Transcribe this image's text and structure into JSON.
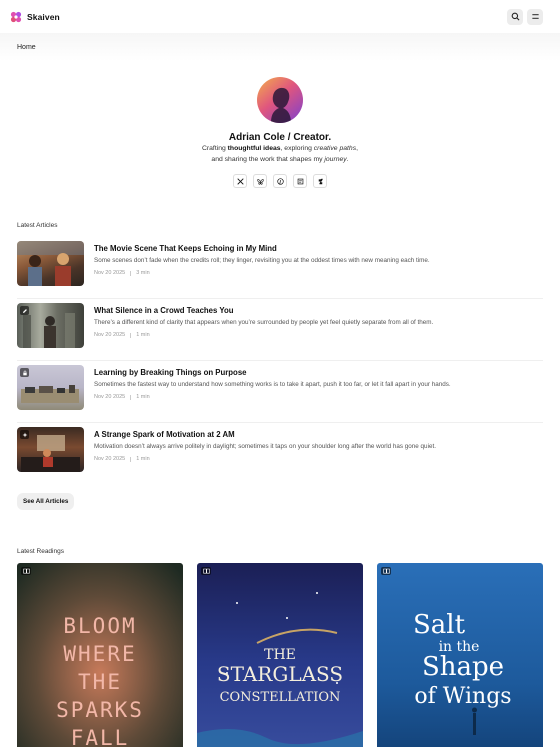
{
  "brand": {
    "name": "Skaiven"
  },
  "breadcrumb": {
    "home": "Home"
  },
  "hero": {
    "name": "Adrian Cole / Creator.",
    "line1_a": "Crafting ",
    "line1_b": "thoughtful ideas",
    "line1_c": ", exploring ",
    "line1_d": "creative paths",
    "line1_e": ",",
    "line2_a": "and sharing the work that shapes my ",
    "line2_b": "journey",
    "line2_c": ".",
    "socials": [
      "x-icon",
      "bluesky-icon",
      "pinterest-icon",
      "flipboard-icon",
      "deviantart-icon"
    ]
  },
  "articles_section": {
    "title": "Latest Articles",
    "see_all": "See All Articles"
  },
  "articles": [
    {
      "title": "The Movie Scene That Keeps Echoing in My Mind",
      "desc": "Some scenes don’t fade when the credits roll; they linger, revisiting you at the oddest times with new meaning each time.",
      "date": "Nov 20 2025",
      "read": "3 min",
      "badge": ""
    },
    {
      "title": "What Silence in a Crowd Teaches You",
      "desc": "There’s a different kind of clarity that appears when you’re surrounded by people yet feel quietly separate from all of them.",
      "date": "Nov 20 2025",
      "read": "1 min",
      "badge": "pen-icon"
    },
    {
      "title": "Learning by Breaking Things on Purpose",
      "desc": "Sometimes the fastest way to understand how something works is to take it apart, push it too far, or let it fall apart in your hands.",
      "date": "Nov 20 2025",
      "read": "1 min",
      "badge": "lock-icon"
    },
    {
      "title": "A Strange Spark of Motivation at 2 AM",
      "desc": "Motivation doesn’t always arrive politely in daylight; sometimes it taps on your shoulder long after the world has gone quiet.",
      "date": "Nov 20 2025",
      "read": "1 min",
      "badge": "sparkle-icon"
    }
  ],
  "readings_section": {
    "title": "Latest Readings"
  },
  "books": [
    {
      "cover_lines": [
        "BLOOM",
        "WHERE",
        "THE",
        "SPARKS",
        "FALL"
      ]
    },
    {
      "cover_lines": [
        "THE",
        "STARGLASS",
        "CONSTELLATION"
      ]
    },
    {
      "cover_lines": [
        "Salt",
        "in the",
        "Shape",
        "of Wings"
      ]
    }
  ],
  "colors": {
    "accent": "#e04fb0",
    "muted": "#999999"
  }
}
